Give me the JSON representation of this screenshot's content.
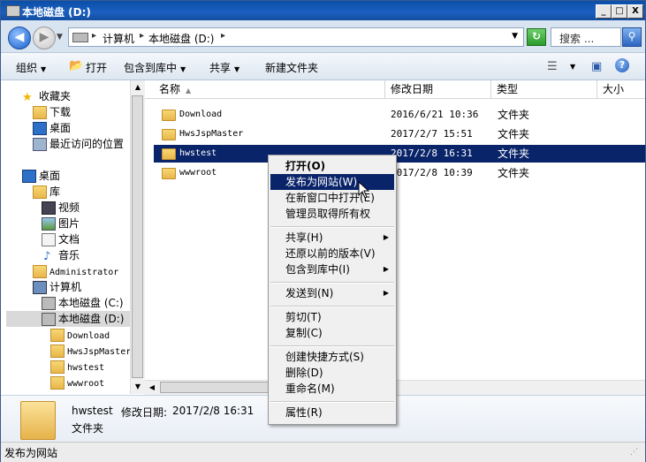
{
  "window": {
    "title": "本地磁盘 (D:)"
  },
  "title_buttons": {
    "minimize": "_",
    "maximize": "□",
    "close": "X"
  },
  "address": {
    "breadcrumbs": [
      "计算机",
      "本地磁盘 (D:)"
    ],
    "search_placeholder": "搜索 ..."
  },
  "toolbar": {
    "organize": "组织",
    "open": "打开",
    "include_in_library": "包含到库中",
    "share": "共享",
    "new_folder": "新建文件夹"
  },
  "nav": {
    "favorites": "收藏夹",
    "downloads": "下载",
    "desktop_fav": "桌面",
    "recent": "最近访问的位置",
    "desktop": "桌面",
    "libraries": "库",
    "video": "视频",
    "pictures": "图片",
    "documents": "文档",
    "music": "音乐",
    "admin": "Administrator",
    "computer": "计算机",
    "drive_c": "本地磁盘 (C:)",
    "drive_d": "本地磁盘 (D:)",
    "sub": [
      "Download",
      "HwsJspMaster",
      "hwstest",
      "wwwroot"
    ]
  },
  "columns": {
    "name": "名称",
    "date": "修改日期",
    "type": "类型",
    "size": "大小"
  },
  "files": [
    {
      "name": "Download",
      "date": "2016/6/21 10:36",
      "type": "文件夹"
    },
    {
      "name": "HwsJspMaster",
      "date": "2017/2/7 15:51",
      "type": "文件夹"
    },
    {
      "name": "hwstest",
      "date": "2017/2/8 16:31",
      "type": "文件夹"
    },
    {
      "name": "wwwroot",
      "date": "2017/2/8 10:39",
      "type": "文件夹"
    }
  ],
  "details": {
    "name": "hwstest",
    "date_label": "修改日期:",
    "date": "2017/2/8 16:31",
    "type": "文件夹"
  },
  "status": "发布为网站",
  "context_menu": {
    "open": "打开(O)",
    "publish": "发布为网站(W)",
    "open_new_window": "在新窗口中打开(E)",
    "take_ownership": "管理员取得所有权",
    "share": "共享(H)",
    "restore": "还原以前的版本(V)",
    "include_library": "包含到库中(I)",
    "send_to": "发送到(N)",
    "cut": "剪切(T)",
    "copy": "复制(C)",
    "create_shortcut": "创建快捷方式(S)",
    "delete": "删除(D)",
    "rename": "重命名(M)",
    "properties": "属性(R)"
  }
}
